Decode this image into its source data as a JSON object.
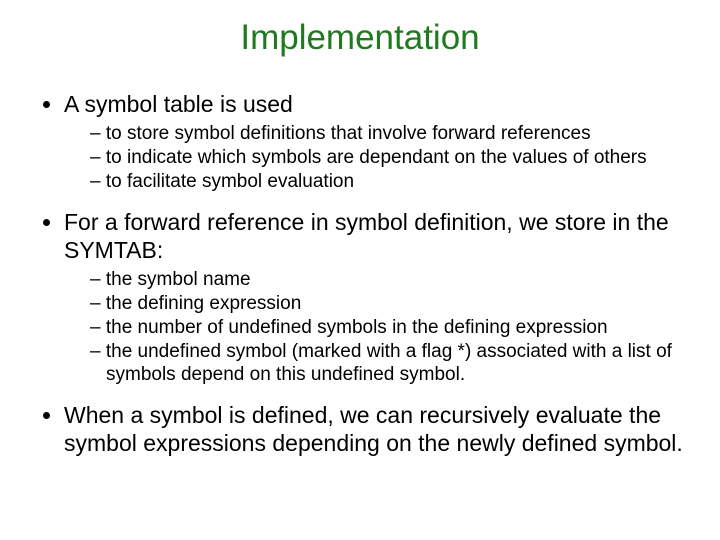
{
  "title": "Implementation",
  "bullets": {
    "b1": {
      "text": "A symbol table is used",
      "sub": [
        "to store symbol definitions that involve forward references",
        "to indicate which symbols are dependant on the values of others",
        "to facilitate symbol evaluation"
      ]
    },
    "b2": {
      "text": "For a forward reference in symbol definition, we store in the SYMTAB:",
      "sub": [
        "the symbol name",
        "the defining expression",
        "the number of undefined symbols in the defining expression",
        "the undefined symbol (marked with a flag *) associated with a list of symbols depend on this undefined symbol."
      ]
    },
    "b3": {
      "text": "When a symbol is defined, we can recursively evaluate the symbol expressions depending on the newly defined symbol."
    }
  }
}
